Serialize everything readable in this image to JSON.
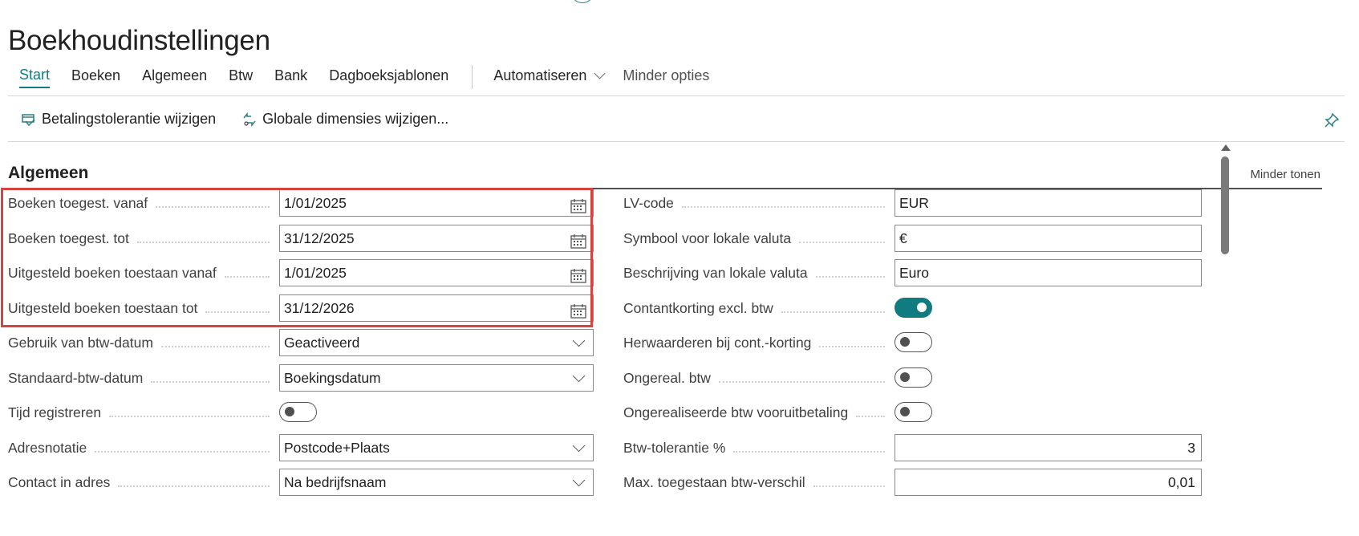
{
  "page": {
    "title": "Boekhoudinstellingen"
  },
  "tabs": [
    {
      "label": "Start",
      "active": true
    },
    {
      "label": "Boeken"
    },
    {
      "label": "Algemeen"
    },
    {
      "label": "Btw"
    },
    {
      "label": "Bank"
    },
    {
      "label": "Dagboeksjablonen"
    }
  ],
  "tabs_extra": {
    "automate": "Automatiseren",
    "less_options": "Minder opties"
  },
  "actions": {
    "payment_tolerance": "Betalingstolerantie wijzigen",
    "global_dimensions": "Globale dimensies wijzigen..."
  },
  "section": {
    "title": "Algemeen",
    "show_less": "Minder tonen"
  },
  "left_fields": [
    {
      "label": "Boeken toegest. vanaf",
      "type": "date",
      "value": "1/01/2025"
    },
    {
      "label": "Boeken toegest. tot",
      "type": "date",
      "value": "31/12/2025"
    },
    {
      "label": "Uitgesteld boeken toestaan vanaf",
      "type": "date",
      "value": "1/01/2025"
    },
    {
      "label": "Uitgesteld boeken toestaan tot",
      "type": "date",
      "value": "31/12/2026"
    },
    {
      "label": "Gebruik van btw-datum",
      "type": "select",
      "value": "Geactiveerd"
    },
    {
      "label": "Standaard-btw-datum",
      "type": "select",
      "value": "Boekingsdatum"
    },
    {
      "label": "Tijd registreren",
      "type": "toggle",
      "value": false
    },
    {
      "label": "Adresnotatie",
      "type": "select",
      "value": "Postcode+Plaats"
    },
    {
      "label": "Contact in adres",
      "type": "select",
      "value": "Na bedrijfsnaam"
    }
  ],
  "right_fields": [
    {
      "label": "LV-code",
      "type": "text",
      "value": "EUR"
    },
    {
      "label": "Symbool voor lokale valuta",
      "type": "text",
      "value": "€"
    },
    {
      "label": "Beschrijving van lokale valuta",
      "type": "text",
      "value": "Euro"
    },
    {
      "label": "Contantkorting excl. btw",
      "type": "toggle",
      "value": true
    },
    {
      "label": "Herwaarderen bij cont.-korting",
      "type": "toggle",
      "value": false
    },
    {
      "label": "Ongereal. btw",
      "type": "toggle",
      "value": false
    },
    {
      "label": "Ongerealiseerde btw vooruitbetaling",
      "type": "toggle",
      "value": false
    },
    {
      "label": "Btw-tolerantie %",
      "type": "number",
      "value": "3"
    },
    {
      "label": "Max. toegestaan btw-verschil",
      "type": "number",
      "value": "0,01"
    }
  ],
  "colors": {
    "accent": "#107c80",
    "highlight": "#d9433f"
  }
}
